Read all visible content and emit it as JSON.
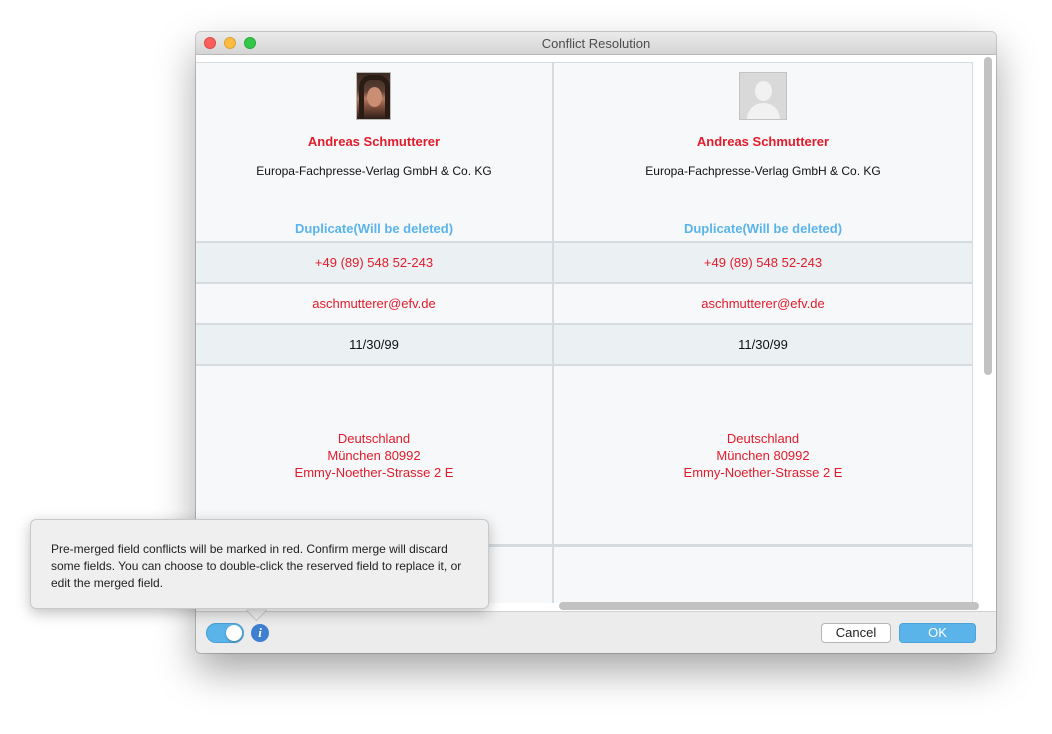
{
  "window": {
    "title": "Conflict Resolution"
  },
  "records": [
    {
      "avatar": "photo-avatar",
      "name": "Andreas Schmutterer",
      "company": "Europa-Fachpresse-Verlag GmbH & Co. KG",
      "status": "Duplicate(Will be deleted)",
      "phone": "+49 (89) 548 52-243",
      "email": "aschmutterer@efv.de",
      "date": "11/30/99",
      "address": [
        "Deutschland",
        "München 80992",
        "Emmy-Noether-Strasse 2 E"
      ]
    },
    {
      "avatar": "placeholder-avatar",
      "name": "Andreas Schmutterer",
      "company": "Europa-Fachpresse-Verlag GmbH & Co. KG",
      "status": "Duplicate(Will be deleted)",
      "phone": "+49 (89) 548 52-243",
      "email": "aschmutterer@efv.de",
      "date": "11/30/99",
      "address": [
        "Deutschland",
        "München 80992",
        "Emmy-Noether-Strasse 2 E"
      ]
    }
  ],
  "tooltip": {
    "text": "Pre-merged field conflicts will be marked in red. Confirm merge will discard some fields. You can choose to double-click the reserved field to replace it, or edit the merged field."
  },
  "footer": {
    "info_icon": "i",
    "cancel_label": "Cancel",
    "ok_label": "OK"
  },
  "colors": {
    "conflict": "#e21b2a",
    "accent": "#5ab4ea"
  }
}
